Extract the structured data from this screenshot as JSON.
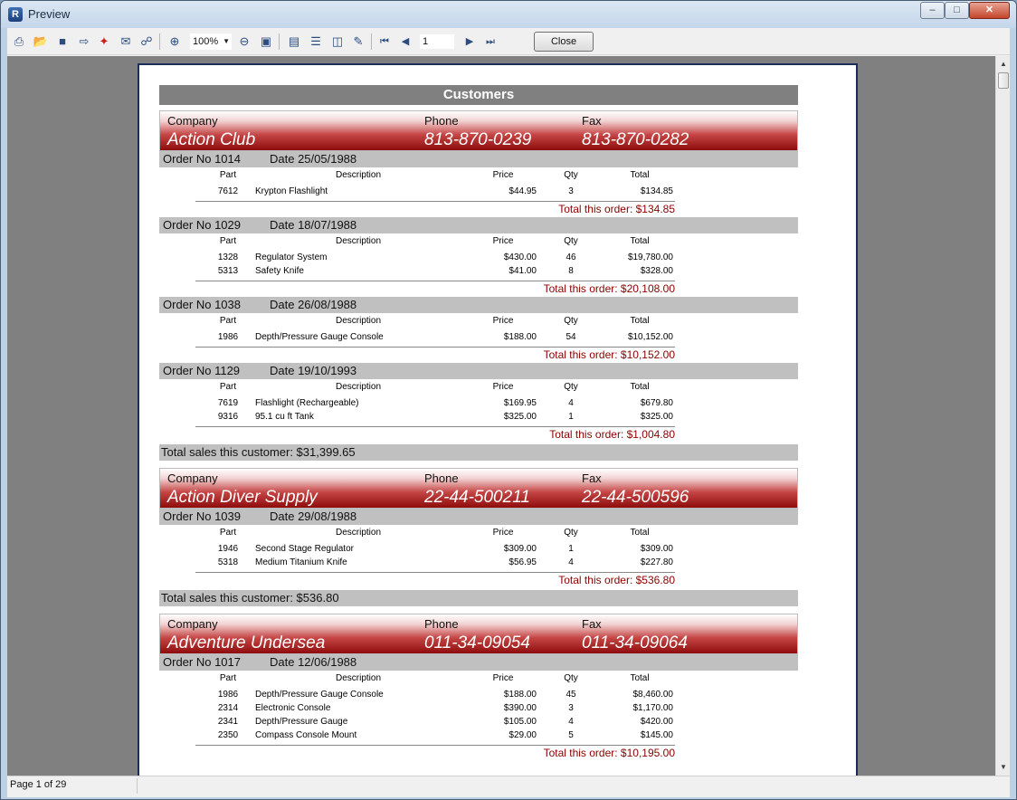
{
  "window": {
    "title": "Preview",
    "app_icon": "R"
  },
  "toolbar": {
    "icons": [
      "print-icon",
      "open-icon",
      "save-icon",
      "export-icon",
      "pdf-icon",
      "email-icon",
      "find-icon",
      "zoom-in-icon",
      "zoom-out-icon",
      "fit-page-icon",
      "page-setup-icon",
      "outline-icon",
      "thumbnails-icon",
      "edit-icon",
      "first-page-icon",
      "prev-page-icon",
      "next-page-icon",
      "last-page-icon"
    ],
    "zoom": "100%",
    "page_number": "1",
    "close_label": "Close"
  },
  "report": {
    "title": "Customers",
    "labels": {
      "company": "Company",
      "phone": "Phone",
      "fax": "Fax",
      "part": "Part",
      "description": "Description",
      "price": "Price",
      "qty": "Qty",
      "total": "Total"
    },
    "customers": [
      {
        "company": "Action Club",
        "phone": "813-870-0239",
        "fax": "813-870-0282",
        "orders": [
          {
            "order_no": "Order No 1014",
            "date": "Date 25/05/1988",
            "items": [
              {
                "part": "7612",
                "description": "Krypton Flashlight",
                "price": "$44.95",
                "qty": "3",
                "total": "$134.85"
              }
            ],
            "order_total": "Total this order: $134.85"
          },
          {
            "order_no": "Order No 1029",
            "date": "Date 18/07/1988",
            "items": [
              {
                "part": "1328",
                "description": "Regulator System",
                "price": "$430.00",
                "qty": "46",
                "total": "$19,780.00"
              },
              {
                "part": "5313",
                "description": "Safety Knife",
                "price": "$41.00",
                "qty": "8",
                "total": "$328.00"
              }
            ],
            "order_total": "Total this order: $20,108.00"
          },
          {
            "order_no": "Order No 1038",
            "date": "Date 26/08/1988",
            "items": [
              {
                "part": "1986",
                "description": "Depth/Pressure Gauge Console",
                "price": "$188.00",
                "qty": "54",
                "total": "$10,152.00"
              }
            ],
            "order_total": "Total this order: $10,152.00"
          },
          {
            "order_no": "Order No 1129",
            "date": "Date 19/10/1993",
            "items": [
              {
                "part": "7619",
                "description": "Flashlight (Rechargeable)",
                "price": "$169.95",
                "qty": "4",
                "total": "$679.80"
              },
              {
                "part": "9316",
                "description": "95.1 cu ft Tank",
                "price": "$325.00",
                "qty": "1",
                "total": "$325.00"
              }
            ],
            "order_total": "Total this order: $1,004.80"
          }
        ],
        "customer_total": "Total sales this customer: $31,399.65"
      },
      {
        "company": "Action Diver Supply",
        "phone": "22-44-500211",
        "fax": "22-44-500596",
        "orders": [
          {
            "order_no": "Order No 1039",
            "date": "Date 29/08/1988",
            "items": [
              {
                "part": "1946",
                "description": "Second Stage Regulator",
                "price": "$309.00",
                "qty": "1",
                "total": "$309.00"
              },
              {
                "part": "5318",
                "description": "Medium Titanium Knife",
                "price": "$56.95",
                "qty": "4",
                "total": "$227.80"
              }
            ],
            "order_total": "Total this order: $536.80"
          }
        ],
        "customer_total": "Total sales this customer: $536.80"
      },
      {
        "company": "Adventure Undersea",
        "phone": "011-34-09054",
        "fax": "011-34-09064",
        "orders": [
          {
            "order_no": "Order No 1017",
            "date": "Date 12/06/1988",
            "items": [
              {
                "part": "1986",
                "description": "Depth/Pressure Gauge Console",
                "price": "$188.00",
                "qty": "45",
                "total": "$8,460.00"
              },
              {
                "part": "2314",
                "description": "Electronic Console",
                "price": "$390.00",
                "qty": "3",
                "total": "$1,170.00"
              },
              {
                "part": "2341",
                "description": "Depth/Pressure Gauge",
                "price": "$105.00",
                "qty": "4",
                "total": "$420.00"
              },
              {
                "part": "2350",
                "description": "Compass Console Mount",
                "price": "$29.00",
                "qty": "5",
                "total": "$145.00"
              }
            ],
            "order_total": "Total this order: $10,195.00"
          }
        ]
      }
    ]
  },
  "status": {
    "page_info": "Page 1 of 29"
  }
}
